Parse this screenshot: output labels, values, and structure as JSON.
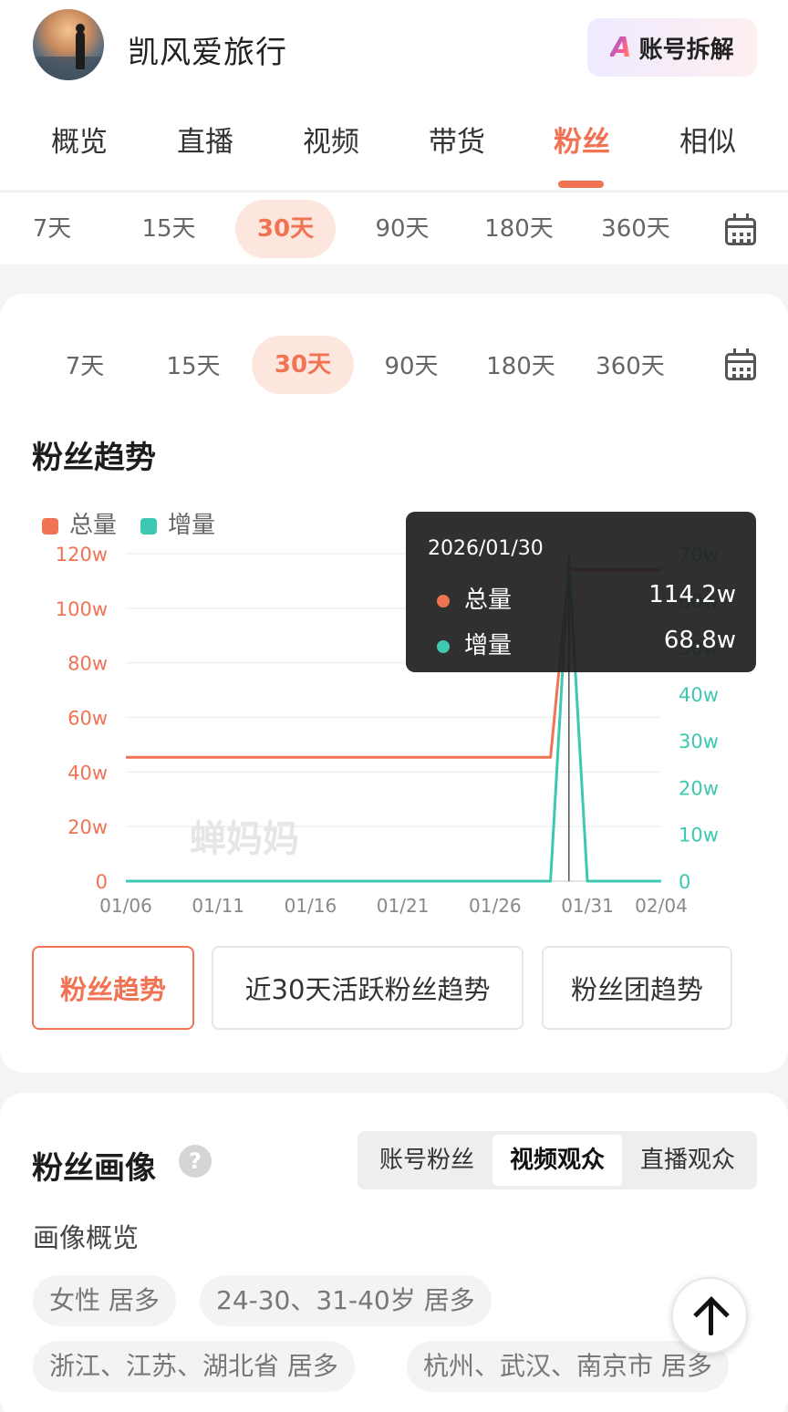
{
  "header": {
    "account_name": "凯风爱旅行",
    "decompose_button": "账号拆解",
    "decompose_logo": "A"
  },
  "main_tabs": [
    "概览",
    "直播",
    "视频",
    "带货",
    "粉丝",
    "相似"
  ],
  "active_main_tab": "粉丝",
  "top_periods": [
    "7天",
    "15天",
    "30天",
    "90天",
    "180天",
    "360天"
  ],
  "active_top_period": "30天",
  "card_periods": [
    "7天",
    "15天",
    "30天",
    "90天",
    "180天",
    "360天"
  ],
  "active_card_period": "30天",
  "fans_trend": {
    "title": "粉丝趋势",
    "legend": [
      "总量",
      "增量"
    ],
    "watermark": "蝉妈妈",
    "tooltip": {
      "date": "2026/01/30",
      "rows": [
        {
          "label": "总量",
          "value": "114.2w"
        },
        {
          "label": "增量",
          "value": "68.8w"
        }
      ]
    }
  },
  "chart_data": {
    "type": "line",
    "title": "粉丝趋势",
    "x": [
      "01/06",
      "01/07",
      "01/08",
      "01/09",
      "01/10",
      "01/11",
      "01/12",
      "01/13",
      "01/14",
      "01/15",
      "01/16",
      "01/17",
      "01/18",
      "01/19",
      "01/20",
      "01/21",
      "01/22",
      "01/23",
      "01/24",
      "01/25",
      "01/26",
      "01/27",
      "01/28",
      "01/29",
      "01/30",
      "01/31",
      "02/01",
      "02/02",
      "02/03",
      "02/04"
    ],
    "x_tick_labels": [
      "01/06",
      "01/11",
      "01/16",
      "01/21",
      "01/26",
      "01/31",
      "02/04"
    ],
    "left_axis": {
      "ticks": [
        "0",
        "20w",
        "40w",
        "60w",
        "80w",
        "100w",
        "120w"
      ],
      "ylim": [
        0,
        120
      ]
    },
    "right_axis": {
      "ticks": [
        "0",
        "10w",
        "20w",
        "30w",
        "40w",
        "50w",
        "60w",
        "70w"
      ],
      "ylim": [
        0,
        70
      ]
    },
    "series": [
      {
        "name": "总量",
        "axis": "left",
        "color": "#f07453",
        "values": [
          45.4,
          45.4,
          45.4,
          45.4,
          45.4,
          45.4,
          45.4,
          45.4,
          45.4,
          45.4,
          45.4,
          45.4,
          45.4,
          45.4,
          45.4,
          45.4,
          45.4,
          45.4,
          45.4,
          45.4,
          45.4,
          45.4,
          45.4,
          45.4,
          114.2,
          114.2,
          114.2,
          114.2,
          114.2,
          114.2
        ]
      },
      {
        "name": "增量",
        "axis": "right",
        "color": "#3ec8b0",
        "values": [
          0,
          0,
          0,
          0,
          0,
          0,
          0,
          0,
          0,
          0,
          0,
          0,
          0,
          0,
          0,
          0,
          0,
          0,
          0,
          0,
          0,
          0,
          0,
          0,
          68.8,
          0,
          0,
          0,
          0,
          0
        ]
      }
    ],
    "grid": true,
    "legend_position": "top-left",
    "highlight_x": "01/30"
  },
  "sub_buttons": [
    "粉丝趋势",
    "近30天活跃粉丝趋势",
    "粉丝团趋势"
  ],
  "active_sub_button": "粉丝趋势",
  "portrait": {
    "title": "粉丝画像",
    "help": "?",
    "segments": [
      "账号粉丝",
      "视频观众",
      "直播观众"
    ],
    "active_segment": "视频观众",
    "overview_label": "画像概览",
    "tags": [
      "女性 居多",
      "24-30、31-40岁 居多",
      "浙江、江苏、湖北省 居多",
      "杭州、武汉、南京市 居多"
    ]
  },
  "colors": {
    "accent": "#f07453",
    "total": "#f07453",
    "increment": "#3ec8b0"
  }
}
